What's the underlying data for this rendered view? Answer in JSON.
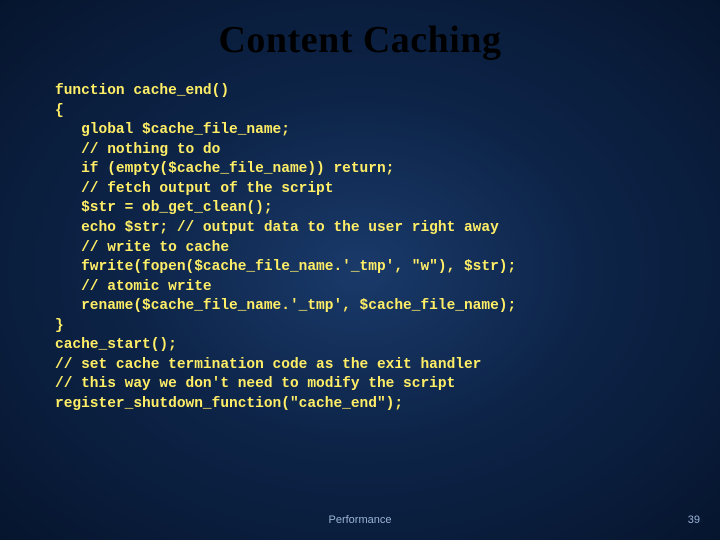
{
  "title": "Content Caching",
  "code": "function cache_end()\n{\n   global $cache_file_name;\n   // nothing to do\n   if (empty($cache_file_name)) return;\n   // fetch output of the script\n   $str = ob_get_clean();\n   echo $str; // output data to the user right away\n   // write to cache\n   fwrite(fopen($cache_file_name.'_tmp', \"w\"), $str);\n   // atomic write\n   rename($cache_file_name.'_tmp', $cache_file_name);\n}\ncache_start();\n// set cache termination code as the exit handler\n// this way we don't need to modify the script\nregister_shutdown_function(\"cache_end\");",
  "footer_center": "Performance",
  "footer_right": "39"
}
